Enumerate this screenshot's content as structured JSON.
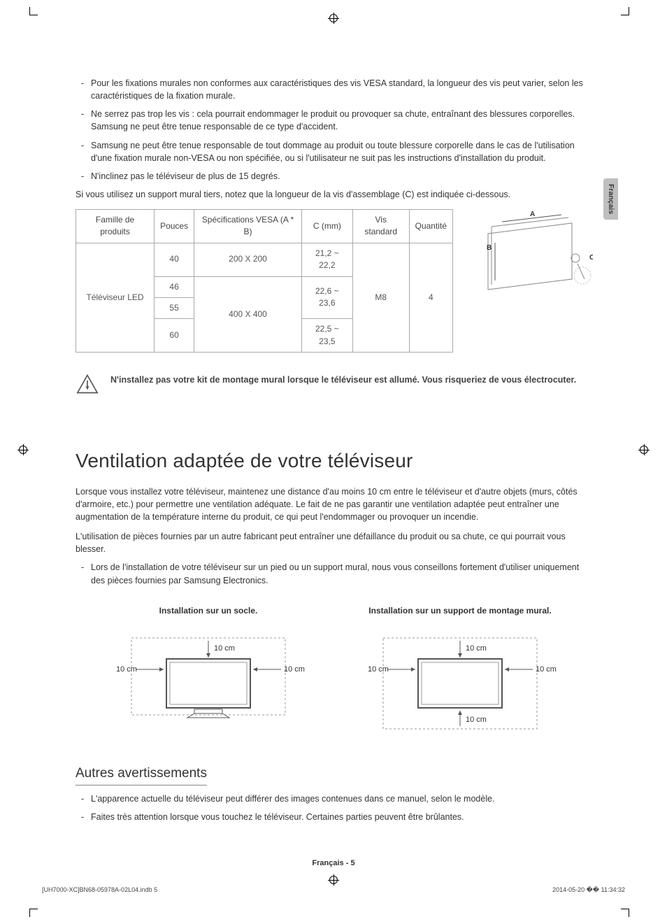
{
  "lang_tab": "Français",
  "bullets_top": [
    "Pour les fixations murales non conformes aux caractéristiques des vis VESA standard, la longueur des vis peut varier, selon les caractéristiques de la fixation murale.",
    "Ne serrez pas trop les vis : cela pourrait endommager le produit ou provoquer sa chute, entraînant des blessures corporelles. Samsung ne peut être tenue responsable de ce type d'accident.",
    "Samsung ne peut être tenue responsable de tout dommage au produit ou toute blessure corporelle dans le cas de l'utilisation d'une fixation murale non-VESA ou non spécifiée, ou si l'utilisateur ne suit pas les instructions d'installation du produit.",
    "N'inclinez pas le téléviseur de plus de 15 degrés."
  ],
  "note_top": "Si vous utilisez un support mural tiers, notez que la longueur de la vis d'assemblage (C) est indiquée ci-dessous.",
  "table": {
    "headers": {
      "family": "Famille de produits",
      "inches": "Pouces",
      "vesa": "Spécifications VESA (A * B)",
      "c": "C (mm)",
      "screw": "Vis standard",
      "qty": "Quantité"
    },
    "family_value": "Téléviseur LED",
    "rows": [
      {
        "inches": "40",
        "vesa": "200 X 200",
        "c": "21,2 ~ 22,2"
      },
      {
        "inches": "46",
        "vesa": "",
        "c": ""
      },
      {
        "inches": "55",
        "vesa": "400 X 400",
        "c": "22,6 ~ 23,6"
      },
      {
        "inches": "60",
        "vesa": "",
        "c": "22,5 ~ 23,5"
      }
    ],
    "screw_value": "M8",
    "qty_value": "4",
    "vesa_merge_2": "400 X 400",
    "c_merge_2": "22,6 ~ 23,6"
  },
  "fig_labels": {
    "A": "A",
    "B": "B",
    "C": "C"
  },
  "warning": "N'installez pas votre kit de montage mural lorsque le téléviseur est allumé. Vous risqueriez de vous électrocuter.",
  "ventilation": {
    "title": "Ventilation adaptée de votre téléviseur",
    "p1": "Lorsque vous installez votre téléviseur, maintenez une distance d'au moins 10 cm entre le téléviseur et d'autre objets (murs, côtés d'armoire, etc.) pour permettre une ventilation adéquate. Le fait de ne pas garantir une ventilation adaptée peut entraîner une augmentation de la température interne du produit, ce qui peut l'endommager ou provoquer un incendie.",
    "p2": "L'utilisation de pièces fournies par un autre fabricant peut entraîner une défaillance du produit ou sa chute, ce qui pourrait vous blesser.",
    "bullet": "Lors de l'installation de votre téléviseur sur un pied ou un support mural, nous vous conseillons fortement d'utiliser uniquement des pièces fournies par Samsung Electronics."
  },
  "diagrams": {
    "stand_title": "Installation sur un socle.",
    "wall_title": "Installation sur un support de montage mural.",
    "dist": "10 cm"
  },
  "autres": {
    "title": "Autres avertissements",
    "items": [
      "L'apparence actuelle du téléviseur peut différer des images contenues dans ce manuel, selon le modèle.",
      "Faites très attention lorsque vous touchez le téléviseur. Certaines parties peuvent être brûlantes."
    ]
  },
  "footer": {
    "page": "Français - 5",
    "left": "[UH7000-XC]BN68-05978A-02L04.indb   5",
    "right": "2014-05-20   �� 11:34:32"
  }
}
